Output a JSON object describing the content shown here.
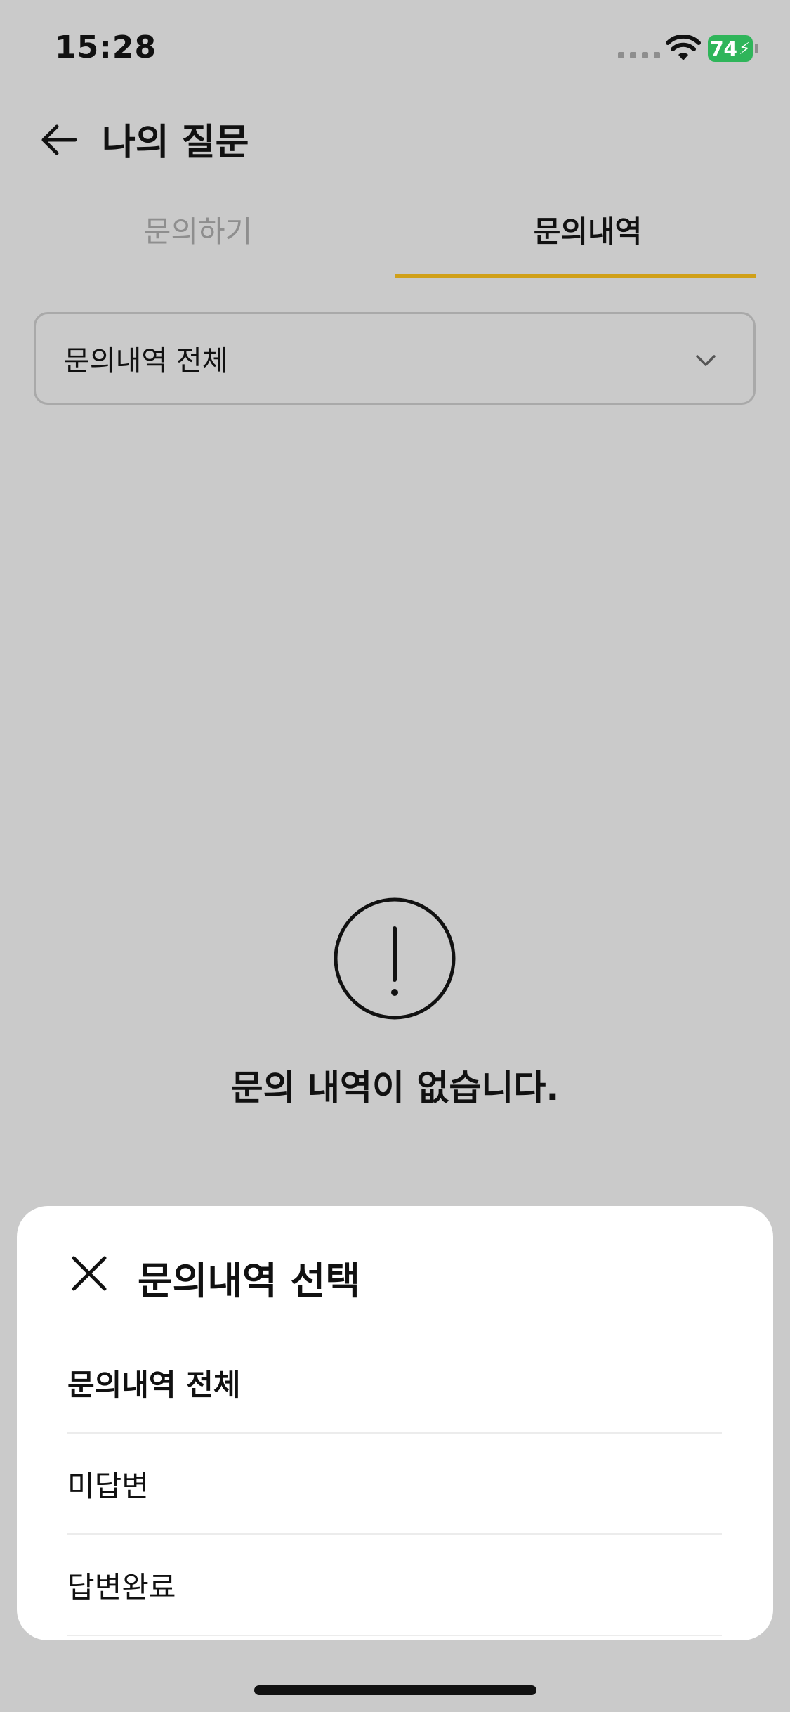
{
  "status_bar": {
    "time": "15:28",
    "battery_level": "74"
  },
  "header": {
    "title": "나의 질문",
    "back_icon": "arrow-left-icon"
  },
  "tabs": [
    {
      "label": "문의하기",
      "active": false
    },
    {
      "label": "문의내역",
      "active": true
    }
  ],
  "filter": {
    "selected_value": "문의내역 전체"
  },
  "empty_state": {
    "icon": "exclamation-circle-icon",
    "message": "문의 내역이 없습니다."
  },
  "bottom_sheet": {
    "title": "문의내역 선택",
    "options": [
      {
        "label": "문의내역 전체",
        "selected": true
      },
      {
        "label": "미답변",
        "selected": false
      },
      {
        "label": "답변완료",
        "selected": false
      }
    ]
  },
  "colors": {
    "accent": "#d0a019",
    "background_dimmed": "#cacaca",
    "sheet_background": "#ffffff",
    "battery": "#2fb55a"
  }
}
